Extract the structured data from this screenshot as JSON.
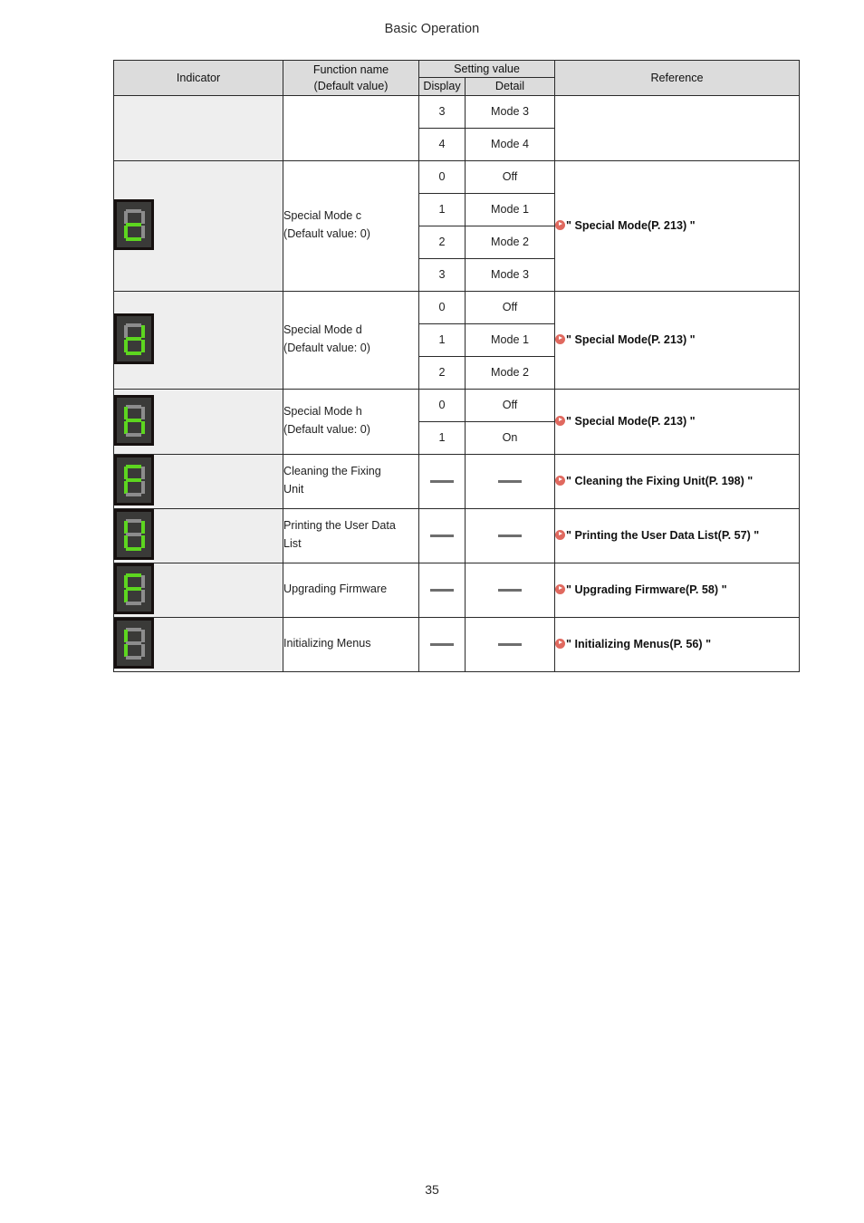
{
  "page": {
    "running_header": "Basic Operation",
    "page_number": "35"
  },
  "table": {
    "headers": {
      "indicator": "Indicator",
      "function_name_line1": "Function name",
      "function_name_line2": "(Default value)",
      "setting_value": "Setting value",
      "display": "Display",
      "detail": "Detail",
      "reference": "Reference"
    },
    "no_value_marker": "—",
    "rows": [
      {
        "id": "continued-row",
        "indicator_segments": null,
        "function_name": "",
        "settings": [
          {
            "display": "3",
            "detail": "Mode 3"
          },
          {
            "display": "4",
            "detail": "Mode 4"
          }
        ],
        "reference": null
      },
      {
        "id": "special-mode-c",
        "indicator_segments": [
          "g",
          "e",
          "d"
        ],
        "indicator_char": "c",
        "function_name_line1": "Special Mode c",
        "function_name_line2": "(Default value: 0)",
        "settings": [
          {
            "display": "0",
            "detail": "Off"
          },
          {
            "display": "1",
            "detail": "Mode 1"
          },
          {
            "display": "2",
            "detail": "Mode 2"
          },
          {
            "display": "3",
            "detail": "Mode 3"
          }
        ],
        "reference": "\" Special Mode(P. 213) \""
      },
      {
        "id": "special-mode-d",
        "indicator_segments": [
          "b",
          "c",
          "d",
          "e",
          "g"
        ],
        "indicator_char": "d",
        "function_name_line1": "Special Mode d",
        "function_name_line2": "(Default value: 0)",
        "settings": [
          {
            "display": "0",
            "detail": "Off"
          },
          {
            "display": "1",
            "detail": "Mode 1"
          },
          {
            "display": "2",
            "detail": "Mode 2"
          }
        ],
        "reference": "\" Special Mode(P. 213) \""
      },
      {
        "id": "special-mode-h",
        "indicator_segments": [
          "f",
          "e",
          "g",
          "c"
        ],
        "indicator_char": "h",
        "function_name_line1": "Special Mode h",
        "function_name_line2": "(Default value: 0)",
        "settings": [
          {
            "display": "0",
            "detail": "Off"
          },
          {
            "display": "1",
            "detail": "On"
          }
        ],
        "reference": "\" Special Mode(P. 213) \""
      },
      {
        "id": "cleaning-fixing-unit",
        "indicator_segments": [
          "a",
          "f",
          "g",
          "e"
        ],
        "indicator_char": "F",
        "function_name_line1": "Cleaning the Fixing",
        "function_name_line2": "Unit",
        "settings": [
          {
            "display": "—",
            "detail": "—"
          }
        ],
        "reference": "\" Cleaning the Fixing Unit(P. 198) \""
      },
      {
        "id": "printing-user-data-list",
        "indicator_segments": [
          "f",
          "b",
          "e",
          "c",
          "d"
        ],
        "indicator_char": "U",
        "function_name_line1": "Printing the User Data",
        "function_name_line2": "List",
        "settings": [
          {
            "display": "—",
            "detail": "—"
          }
        ],
        "reference": "\" Printing the User Data List(P. 57) \""
      },
      {
        "id": "upgrading-firmware",
        "indicator_segments": [
          "a",
          "f",
          "g",
          "e"
        ],
        "indicator_char": "F",
        "function_name_line1": "Upgrading Firmware",
        "function_name_line2": "",
        "settings": [
          {
            "display": "—",
            "detail": "—"
          }
        ],
        "reference": "\" Upgrading Firmware(P. 58) \""
      },
      {
        "id": "initializing-menus",
        "indicator_segments": [
          "f",
          "e"
        ],
        "indicator_char": "I",
        "function_name_line1": "Initializing Menus",
        "function_name_line2": "",
        "settings": [
          {
            "display": "—",
            "detail": "—"
          }
        ],
        "reference": "\" Initializing Menus(P. 56) \""
      }
    ]
  },
  "colors": {
    "header_fill": "#dcdcdc",
    "indicator_cell_fill": "#eeeeee",
    "segment_on": "#5dd61f",
    "segment_off": "#8c8c8c",
    "display_bezel": "#3a3a38",
    "reference_icon": "#e0695f"
  }
}
